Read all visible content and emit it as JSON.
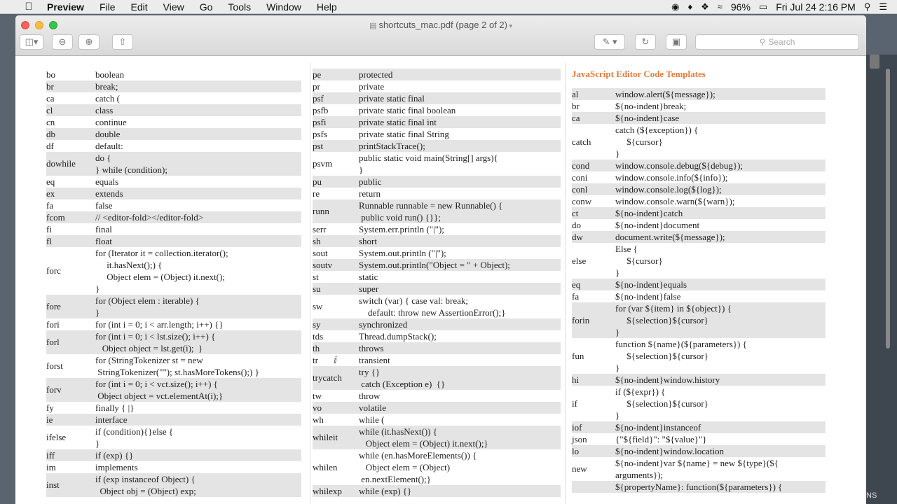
{
  "menubar": {
    "app": "Preview",
    "items": [
      "File",
      "Edit",
      "View",
      "Go",
      "Tools",
      "Window",
      "Help"
    ],
    "battery": "96%",
    "clock": "Fri Jul 24  2:16 PM"
  },
  "window": {
    "title": "shortcuts_mac.pdf (page 2 of 2)",
    "search_placeholder": "Search"
  },
  "col1": [
    {
      "ab": "bo",
      "lines": [
        "boolean"
      ]
    },
    {
      "ab": "br",
      "lines": [
        "break;"
      ]
    },
    {
      "ab": "ca",
      "lines": [
        "catch ("
      ]
    },
    {
      "ab": "cl",
      "lines": [
        "class"
      ]
    },
    {
      "ab": "cn",
      "lines": [
        "continue"
      ]
    },
    {
      "ab": "db",
      "lines": [
        "double"
      ]
    },
    {
      "ab": "df",
      "lines": [
        "default:"
      ]
    },
    {
      "ab": "dowhile",
      "lines": [
        "do {",
        "} while (condition);"
      ]
    },
    {
      "ab": "eq",
      "lines": [
        "equals"
      ]
    },
    {
      "ab": "ex",
      "lines": [
        "extends"
      ]
    },
    {
      "ab": "fa",
      "lines": [
        "false"
      ]
    },
    {
      "ab": "fcom",
      "lines": [
        "// <editor-fold></editor-fold>"
      ]
    },
    {
      "ab": "fi",
      "lines": [
        "final"
      ]
    },
    {
      "ab": "fl",
      "lines": [
        "float"
      ]
    },
    {
      "ab": "forc",
      "lines": [
        "for (Iterator it = collection.iterator();",
        "     it.hasNext();) {",
        "     Object elem = (Object) it.next();",
        "}"
      ]
    },
    {
      "ab": "fore",
      "lines": [
        "for (Object elem : iterable) {",
        "}"
      ]
    },
    {
      "ab": "fori",
      "lines": [
        "for (int i = 0; i < arr.length; i++) {}"
      ]
    },
    {
      "ab": "forl",
      "lines": [
        "for (int i = 0; i < lst.size(); i++) {",
        "   Object object = lst.get(i);  }"
      ]
    },
    {
      "ab": "forst",
      "lines": [
        "for (StringTokenizer st = new",
        " StringTokenizer(\"\"); st.hasMoreTokens();) }"
      ]
    },
    {
      "ab": "forv",
      "lines": [
        "for (int i = 0; i < vct.size(); i++) {",
        " Object object = vct.elementAt(i);}"
      ]
    },
    {
      "ab": "fy",
      "lines": [
        "finally { |}"
      ]
    },
    {
      "ab": "ie",
      "lines": [
        "interface"
      ]
    },
    {
      "ab": "ifelse",
      "lines": [
        "if (condition){}else {",
        "}"
      ]
    },
    {
      "ab": "iff",
      "lines": [
        "if (exp) {}"
      ]
    },
    {
      "ab": "im",
      "lines": [
        "implements"
      ]
    },
    {
      "ab": "inst",
      "lines": [
        "if (exp instanceof Object) {",
        "  Object obj = (Object) exp;"
      ]
    }
  ],
  "col2": [
    {
      "ab": "pe",
      "lines": [
        "protected"
      ]
    },
    {
      "ab": "pr",
      "lines": [
        "private"
      ]
    },
    {
      "ab": "psf",
      "lines": [
        "private static final"
      ]
    },
    {
      "ab": "psfb",
      "lines": [
        "private static final boolean"
      ]
    },
    {
      "ab": "psfi",
      "lines": [
        "private static final int"
      ]
    },
    {
      "ab": "psfs",
      "lines": [
        "private static final String"
      ]
    },
    {
      "ab": "pst",
      "lines": [
        "printStackTrace();"
      ]
    },
    {
      "ab": "psvm",
      "lines": [
        "public static void main(String[] args){",
        "}"
      ]
    },
    {
      "ab": "pu",
      "lines": [
        "public"
      ]
    },
    {
      "ab": "re",
      "lines": [
        "return"
      ]
    },
    {
      "ab": "runn",
      "lines": [
        "Runnable runnable = new Runnable() {",
        " public void run() {}};"
      ]
    },
    {
      "ab": "serr",
      "lines": [
        "System.err.println (\"|\");"
      ]
    },
    {
      "ab": "sh",
      "lines": [
        "short"
      ]
    },
    {
      "ab": "sout",
      "lines": [
        "System.out.println (\"|\");"
      ]
    },
    {
      "ab": "soutv",
      "lines": [
        "System.out.println(\"Object = \" + Object);"
      ]
    },
    {
      "ab": "st",
      "lines": [
        "static"
      ]
    },
    {
      "ab": "su",
      "lines": [
        "super"
      ]
    },
    {
      "ab": "sw",
      "lines": [
        "switch (var) { case val: break;",
        "    default: throw new AssertionError();}"
      ]
    },
    {
      "ab": "sy",
      "lines": [
        "synchronized"
      ]
    },
    {
      "ab": "tds",
      "lines": [
        "Thread.dumpStack();"
      ]
    },
    {
      "ab": "th",
      "lines": [
        "throws"
      ]
    },
    {
      "ab": "tr",
      "lines": [
        "transient"
      ]
    },
    {
      "ab": "trycatch",
      "lines": [
        "try {}",
        " catch (Exception e)  {}"
      ]
    },
    {
      "ab": "tw",
      "lines": [
        "throw"
      ]
    },
    {
      "ab": "vo",
      "lines": [
        "volatile"
      ]
    },
    {
      "ab": "wh",
      "lines": [
        "while ("
      ]
    },
    {
      "ab": "whileit",
      "lines": [
        "while (it.hasNext()) {",
        "   Object elem = (Object) it.next();}"
      ]
    },
    {
      "ab": "whilen",
      "lines": [
        "while (en.hasMoreElements()) {",
        "   Object elem = (Object)",
        " en.nextElement();}"
      ]
    },
    {
      "ab": "whilexp",
      "lines": [
        "while (exp) {}"
      ]
    }
  ],
  "col3": {
    "heading": "JavaScript Editor Code Templates",
    "rows": [
      {
        "ab": "al",
        "lines": [
          "window.alert(${message});"
        ]
      },
      {
        "ab": "br",
        "lines": [
          "${no-indent}break;"
        ]
      },
      {
        "ab": "ca",
        "lines": [
          "${no-indent}case"
        ]
      },
      {
        "ab": "catch",
        "lines": [
          "catch (${exception}) {",
          "     ${cursor}",
          "}"
        ]
      },
      {
        "ab": "cond",
        "lines": [
          "window.console.debug(${debug});"
        ]
      },
      {
        "ab": "coni",
        "lines": [
          "window.console.info(${info});"
        ]
      },
      {
        "ab": "conl",
        "lines": [
          "window.console.log(${log});"
        ]
      },
      {
        "ab": "conw",
        "lines": [
          "window.console.warn(${warn});"
        ]
      },
      {
        "ab": "ct",
        "lines": [
          "${no-indent}catch"
        ]
      },
      {
        "ab": "do",
        "lines": [
          "${no-indent}document"
        ]
      },
      {
        "ab": "dw",
        "lines": [
          "document.write(${message});"
        ]
      },
      {
        "ab": "else",
        "lines": [
          "Else {",
          "     ${cursor}",
          "}"
        ]
      },
      {
        "ab": "eq",
        "lines": [
          "${no-indent}equals"
        ]
      },
      {
        "ab": "fa",
        "lines": [
          "${no-indent}false"
        ]
      },
      {
        "ab": "forin",
        "lines": [
          "for (var ${item} in ${object}) {",
          "     ${selection}${cursor}",
          "}"
        ]
      },
      {
        "ab": "fun",
        "lines": [
          "function ${name}(${parameters}) {",
          "     ${selection}${cursor}",
          "}"
        ]
      },
      {
        "ab": "hi",
        "lines": [
          "${no-indent}window.history"
        ]
      },
      {
        "ab": "if",
        "lines": [
          "if (${expr}) {",
          "     ${selection}${cursor}",
          "}"
        ]
      },
      {
        "ab": "iof",
        "lines": [
          "${no-indent}instanceof"
        ]
      },
      {
        "ab": "json",
        "lines": [
          "{\"${field}\": \"${value}\"}"
        ]
      },
      {
        "ab": "lo",
        "lines": [
          "${no-indent}window.location"
        ]
      },
      {
        "ab": "new",
        "lines": [
          "${no-indent}var ${name} = new ${type}(${",
          "arguments});"
        ]
      },
      {
        "ab": "",
        "lines": [
          "${propertyName}: function(${parameters}) {"
        ]
      }
    ]
  },
  "dock_label": "NS"
}
